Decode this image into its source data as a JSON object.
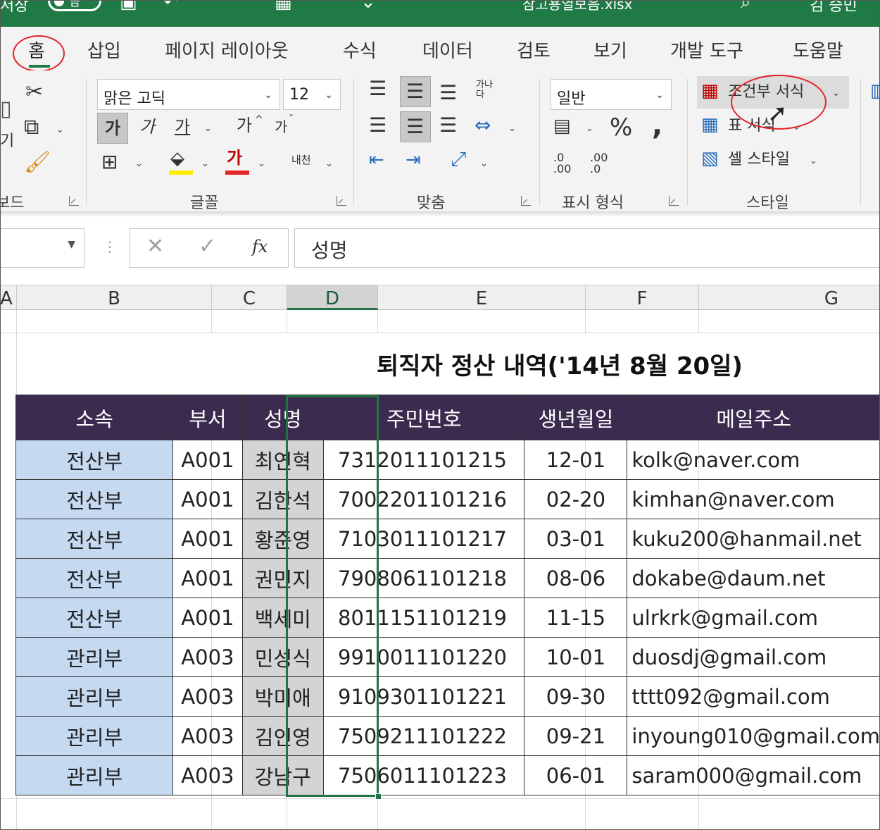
{
  "titlebar": {
    "autosave_label": "저장",
    "toggle_label": "끔",
    "filename": "참고용열보음.xlsx",
    "user": "김 승민"
  },
  "ribbon_tabs": {
    "home": "홈",
    "insert": "삽입",
    "page_layout": "페이지 레이아웃",
    "formulas": "수식",
    "data": "데이터",
    "review": "검토",
    "view": "보기",
    "developer": "개발 도구",
    "help": "도움말"
  },
  "clipboard": {
    "paste_label": "기",
    "group_label": "보드"
  },
  "font": {
    "font_name": "맑은 고딕",
    "font_size": "12",
    "bold": "가",
    "italic": "가",
    "underline": "가",
    "grow": "가",
    "shrink": "가",
    "font_color": "가",
    "phonetic": "내천",
    "group_label": "글꼴"
  },
  "alignment": {
    "wrap_text": "가나다",
    "group_label": "맞춤"
  },
  "number": {
    "format": "일반",
    "percent": "%",
    "comma": ",",
    "inc_decimal": ".0 .00",
    "dec_decimal": ".00 .0",
    "group_label": "표시 형식"
  },
  "styles": {
    "conditional_formatting": "조건부 서식",
    "format_as_table": "표 서식",
    "cell_styles": "셀 스타일",
    "group_label": "스타일"
  },
  "formula_bar": {
    "cancel": "✕",
    "enter": "✓",
    "fx": "fx",
    "content": "성명"
  },
  "column_headers": [
    "A",
    "B",
    "C",
    "D",
    "E",
    "F",
    "G"
  ],
  "sheet": {
    "title": "퇴직자 정산 내역('14년 8월 20일)",
    "headers": [
      "소속",
      "부서",
      "성명",
      "주민번호",
      "생년월일",
      "메일주소"
    ],
    "rows": [
      [
        "전산부",
        "A001",
        "최연혁",
        "7312011101215",
        "12-01",
        "kolk@naver.com"
      ],
      [
        "전산부",
        "A001",
        "김한석",
        "7002201101216",
        "02-20",
        "kimhan@naver.com"
      ],
      [
        "전산부",
        "A001",
        "황준영",
        "7103011101217",
        "03-01",
        "kuku200@hanmail.net"
      ],
      [
        "전산부",
        "A001",
        "권민지",
        "7908061101218",
        "08-06",
        "dokabe@daum.net"
      ],
      [
        "전산부",
        "A001",
        "백세미",
        "8011151101219",
        "11-15",
        "ulrkrk@gmail.com"
      ],
      [
        "관리부",
        "A003",
        "민성식",
        "9910011101220",
        "10-01",
        "duosdj@gmail.com"
      ],
      [
        "관리부",
        "A003",
        "박미애",
        "9109301101221",
        "09-30",
        "tttt092@gmail.com"
      ],
      [
        "관리부",
        "A003",
        "김인영",
        "7509211101222",
        "09-21",
        "inyoung010@gmail.com"
      ],
      [
        "관리부",
        "A003",
        "강남구",
        "7506011101223",
        "06-01",
        "saram000@gmail.com"
      ]
    ]
  }
}
